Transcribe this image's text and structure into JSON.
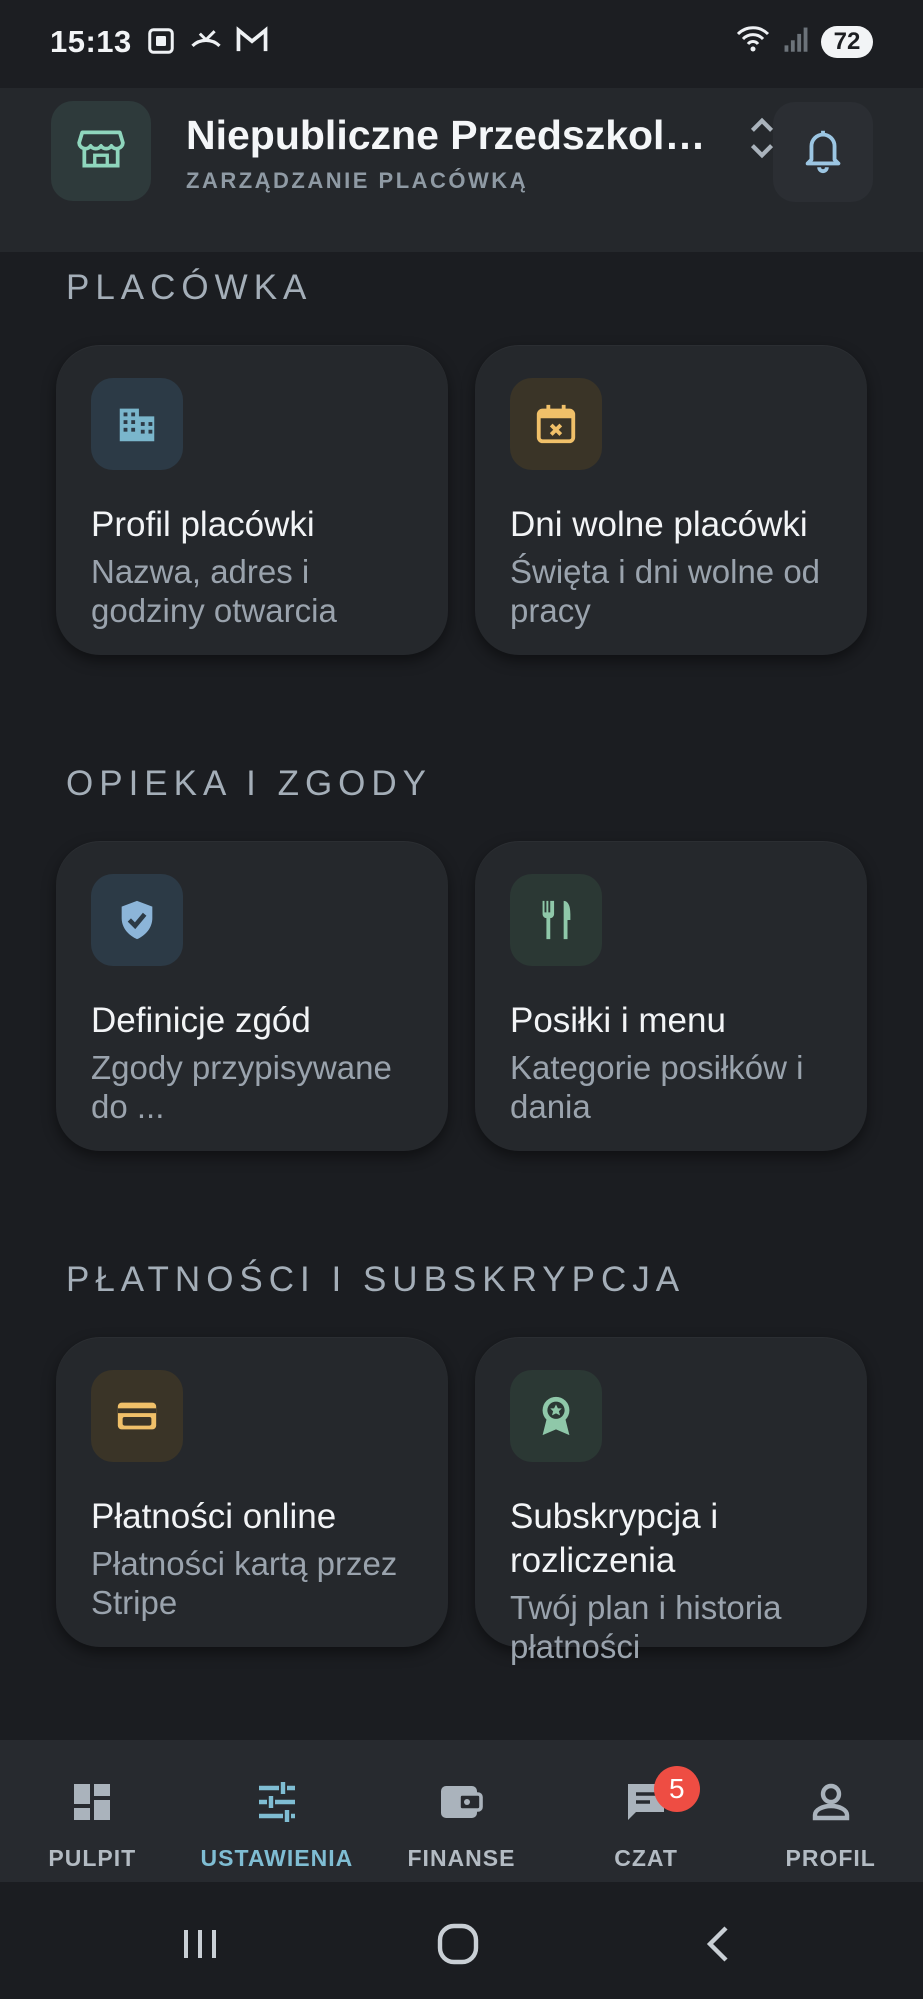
{
  "status_bar": {
    "time": "15:13",
    "battery": "72",
    "icons_left": [
      "screenshot-icon",
      "missed-call-icon",
      "gmail-icon"
    ],
    "icons_right": [
      "wifi-icon",
      "signal-icon",
      "battery-icon"
    ]
  },
  "header": {
    "title": "Niepubliczne Przedszkole \"...",
    "subtitle": "ZARZĄDZANIE PLACÓWKĄ",
    "logo_icon": "storefront-icon",
    "switch_icon": "unfold-icon",
    "bell_icon": "bell-icon"
  },
  "sections": [
    {
      "title": "PLACÓWKA",
      "cards": [
        {
          "title": "Profil placówki",
          "description": "Nazwa, adres i godziny otwarcia",
          "icon": "building-icon",
          "accent": "#7ab6cc"
        },
        {
          "title": "Dni wolne placówki",
          "description": "Święta i dni wolne od pracy",
          "icon": "calendar-x-icon",
          "accent": "#f0c069"
        }
      ]
    },
    {
      "title": "OPIEKA I ZGODY",
      "cards": [
        {
          "title": "Definicje zgód",
          "description": "Zgody przypisywane do ...",
          "icon": "shield-check-icon",
          "accent": "#8cb5d9"
        },
        {
          "title": "Posiłki i menu",
          "description": "Kategorie posiłków i dania",
          "icon": "fork-knife-icon",
          "accent": "#8fc8a9"
        }
      ]
    },
    {
      "title": "PŁATNOŚCI I SUBSKRYPCJA",
      "cards": [
        {
          "title": "Płatności online",
          "description": "Płatności kartą przez Stripe",
          "icon": "credit-card-icon",
          "accent": "#f0c069"
        },
        {
          "title": "Subskrypcja i rozliczenia",
          "description": "Twój plan i historia płatności",
          "icon": "award-icon",
          "accent": "#8fc8a9"
        }
      ]
    }
  ],
  "bottom_nav": {
    "active": "USTAWIENIA",
    "items": [
      {
        "label": "PULPIT",
        "icon": "dashboard-icon"
      },
      {
        "label": "USTAWIENIA",
        "icon": "tune-icon"
      },
      {
        "label": "FINANSE",
        "icon": "wallet-icon"
      },
      {
        "label": "CZAT",
        "icon": "chat-icon",
        "badge": "5"
      },
      {
        "label": "PROFIL",
        "icon": "person-icon"
      }
    ]
  },
  "system_nav": [
    "recents-icon",
    "home-icon",
    "back-icon"
  ],
  "colors": {
    "background": "#1b1d21",
    "card": "#25282c",
    "accent_active": "#7fbdd3",
    "badge": "#ee4d43"
  }
}
